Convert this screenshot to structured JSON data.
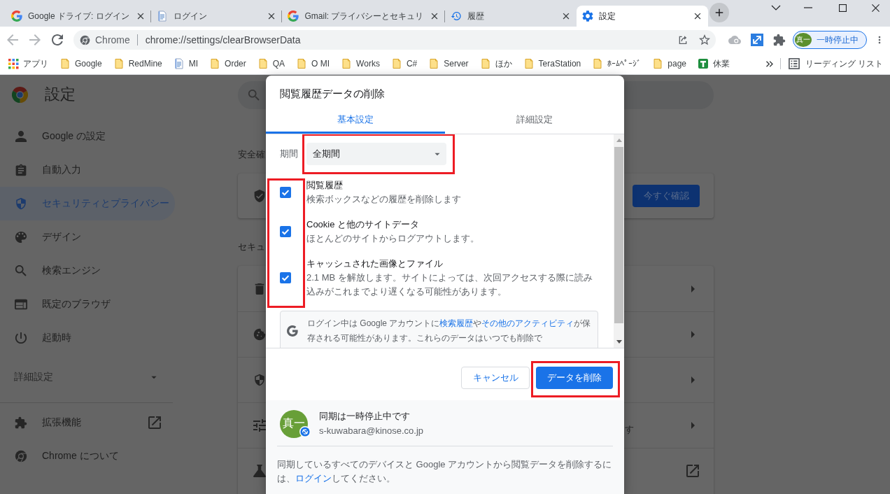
{
  "tabs": [
    {
      "title": "Google ドライブ: ログイン",
      "selected": false
    },
    {
      "title": "ログイン",
      "selected": false
    },
    {
      "title": "Gmail: プライバシーとセキュリ",
      "selected": false
    },
    {
      "title": "履歴",
      "selected": false
    },
    {
      "title": "設定",
      "selected": true
    }
  ],
  "toolbar": {
    "back_disabled": true,
    "forward_disabled": true,
    "site_label": "Chrome",
    "url": "chrome://settings/clearBrowserData",
    "profile": {
      "avatar": "真一",
      "status": "一時停止中"
    }
  },
  "bookmarks": {
    "items": [
      {
        "label": "アプリ"
      },
      {
        "label": "Google"
      },
      {
        "label": "RedMine"
      },
      {
        "label": "MI"
      },
      {
        "label": "Order"
      },
      {
        "label": "QA"
      },
      {
        "label": "O MI"
      },
      {
        "label": "Works"
      },
      {
        "label": "C#"
      },
      {
        "label": "Server"
      },
      {
        "label": "ほか"
      },
      {
        "label": "TeraStation"
      },
      {
        "label": "ﾎｰﾑﾍﾟｰｼﾞ"
      },
      {
        "label": "page"
      },
      {
        "label": "休業"
      }
    ],
    "reading_list": "リーディング リスト"
  },
  "settings": {
    "title": "設定",
    "sidebar": {
      "items": [
        {
          "label": "Google の設定",
          "selected": false
        },
        {
          "label": "自動入力",
          "selected": false
        },
        {
          "label": "セキュリティとプライバシー",
          "selected": true
        },
        {
          "label": "デザイン",
          "selected": false
        },
        {
          "label": "検索エンジン",
          "selected": false
        },
        {
          "label": "既定のブラウザ",
          "selected": false
        },
        {
          "label": "起動時",
          "selected": false
        }
      ],
      "advanced": "詳細設定",
      "links": [
        {
          "label": "拡張機能"
        },
        {
          "label": "Chrome について"
        }
      ]
    },
    "safety_check": {
      "heading": "安全確",
      "button": "今すぐ確認"
    },
    "privacy": {
      "heading": "セキュ",
      "rows": [
        {
          "kind": "submenu"
        },
        {
          "kind": "submenu"
        },
        {
          "kind": "submenu"
        },
        {
          "kind": "submenu",
          "text": "す"
        },
        {
          "kind": "external"
        }
      ]
    }
  },
  "dialog": {
    "title": "閲覧履歴データの削除",
    "tabs": [
      {
        "label": "基本設定",
        "selected": true
      },
      {
        "label": "詳細設定",
        "selected": false
      }
    ],
    "time_range": {
      "label": "期間",
      "value": "全期間",
      "highlighted": true
    },
    "checkboxes_highlighted": true,
    "options": [
      {
        "title": "閲覧履歴",
        "description": "検索ボックスなどの履歴を削除します",
        "checked": true
      },
      {
        "title": "Cookie と他のサイトデータ",
        "description": "ほとんどのサイトからログアウトします。",
        "checked": true
      },
      {
        "title": "キャッシュされた画像とファイル",
        "description": "2.1 MB を解放します。サイトによっては、次回アクセスする際に読み込みがこれまでより遅くなる可能性があります。",
        "checked": true
      }
    ],
    "notice": [
      {
        "text": "ログイン中は Google アカウントに",
        "link": false
      },
      {
        "text": "検索履歴",
        "link": true
      },
      {
        "text": "や",
        "link": false
      },
      {
        "text": "その他のアクティビティ",
        "link": true
      },
      {
        "text": "が保存される可能性があります。これらのデータはいつでも削除で",
        "link": false
      }
    ],
    "buttons": [
      {
        "label": "キャンセル",
        "kind": "secondary",
        "highlighted": false
      },
      {
        "label": "データを削除",
        "kind": "primary",
        "highlighted": true
      }
    ],
    "sync": {
      "avatar": "真一",
      "status": "同期は一時停止中です",
      "email": "s-kuwabara@kinose.co.jp",
      "note": [
        {
          "text": "同期しているすべてのデバイスと Google アカウントから閲覧データを削除するには、",
          "link": false
        },
        {
          "text": "ログイン",
          "link": true
        },
        {
          "text": "してください。",
          "link": false
        }
      ]
    }
  }
}
